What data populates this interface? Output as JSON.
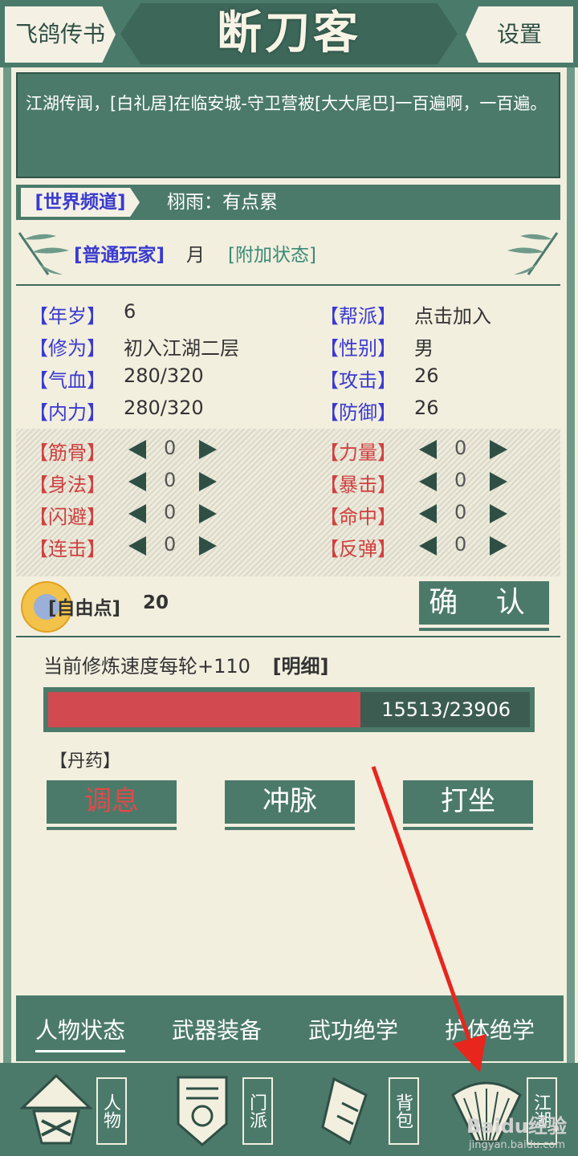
{
  "header": {
    "left_button": "飞鸽传书",
    "title": "断刀客",
    "right_button": "设置"
  },
  "news": {
    "text": "江湖传闻，[白礼居]在临安城-守卫营被[大大尾巴]一百遍啊，一百遍。"
  },
  "chat": {
    "channel": "[世界频道]",
    "message": "栩雨：有点累"
  },
  "player": {
    "tag": "[普通玩家]",
    "name": "月",
    "status": "[附加状态]"
  },
  "stats": [
    {
      "label": "【年岁】",
      "value": "6"
    },
    {
      "label": "【帮派】",
      "value": "点击加入"
    },
    {
      "label": "【修为】",
      "value": "初入江湖二层"
    },
    {
      "label": "【性别】",
      "value": "男"
    },
    {
      "label": "【气血】",
      "value": "280/320"
    },
    {
      "label": "【攻击】",
      "value": "26"
    },
    {
      "label": "【内力】",
      "value": "280/320"
    },
    {
      "label": "【防御】",
      "value": "26"
    }
  ],
  "attributes": [
    {
      "label": "【筋骨】",
      "value": "0"
    },
    {
      "label": "【力量】",
      "value": "0"
    },
    {
      "label": "【身法】",
      "value": "0"
    },
    {
      "label": "【暴击】",
      "value": "0"
    },
    {
      "label": "【闪避】",
      "value": "0"
    },
    {
      "label": "【命中】",
      "value": "0"
    },
    {
      "label": "【连击】",
      "value": "0"
    },
    {
      "label": "【反弹】",
      "value": "0"
    }
  ],
  "points": {
    "label": "[自由点]",
    "value": "20",
    "confirm": "确 认"
  },
  "cultivation": {
    "text": "当前修炼速度每轮+110",
    "detail": "[明细]",
    "progress": "15513/23906",
    "fraction": 0.649
  },
  "pill": {
    "label": "【丹药】"
  },
  "actions": [
    "调息",
    "冲脉",
    "打坐"
  ],
  "tabs": [
    "人物状态",
    "武器装备",
    "武功绝学",
    "护体绝学"
  ],
  "nav": [
    {
      "label": "人物",
      "icon": "straw-hat-icon"
    },
    {
      "label": "门派",
      "icon": "banner-icon"
    },
    {
      "label": "背包",
      "icon": "scroll-bag-icon"
    },
    {
      "label": "江湖",
      "icon": "fan-icon"
    }
  ],
  "watermark": {
    "brand": "Baidu经验",
    "url": "jingyan.baidu.com"
  },
  "colors": {
    "accent": "#4b7a6a",
    "paper": "#f2efdf",
    "blue_label": "#3a3ad0",
    "red_label": "#d04040",
    "progress": "#d24a50",
    "arrow": "#e8261e"
  }
}
